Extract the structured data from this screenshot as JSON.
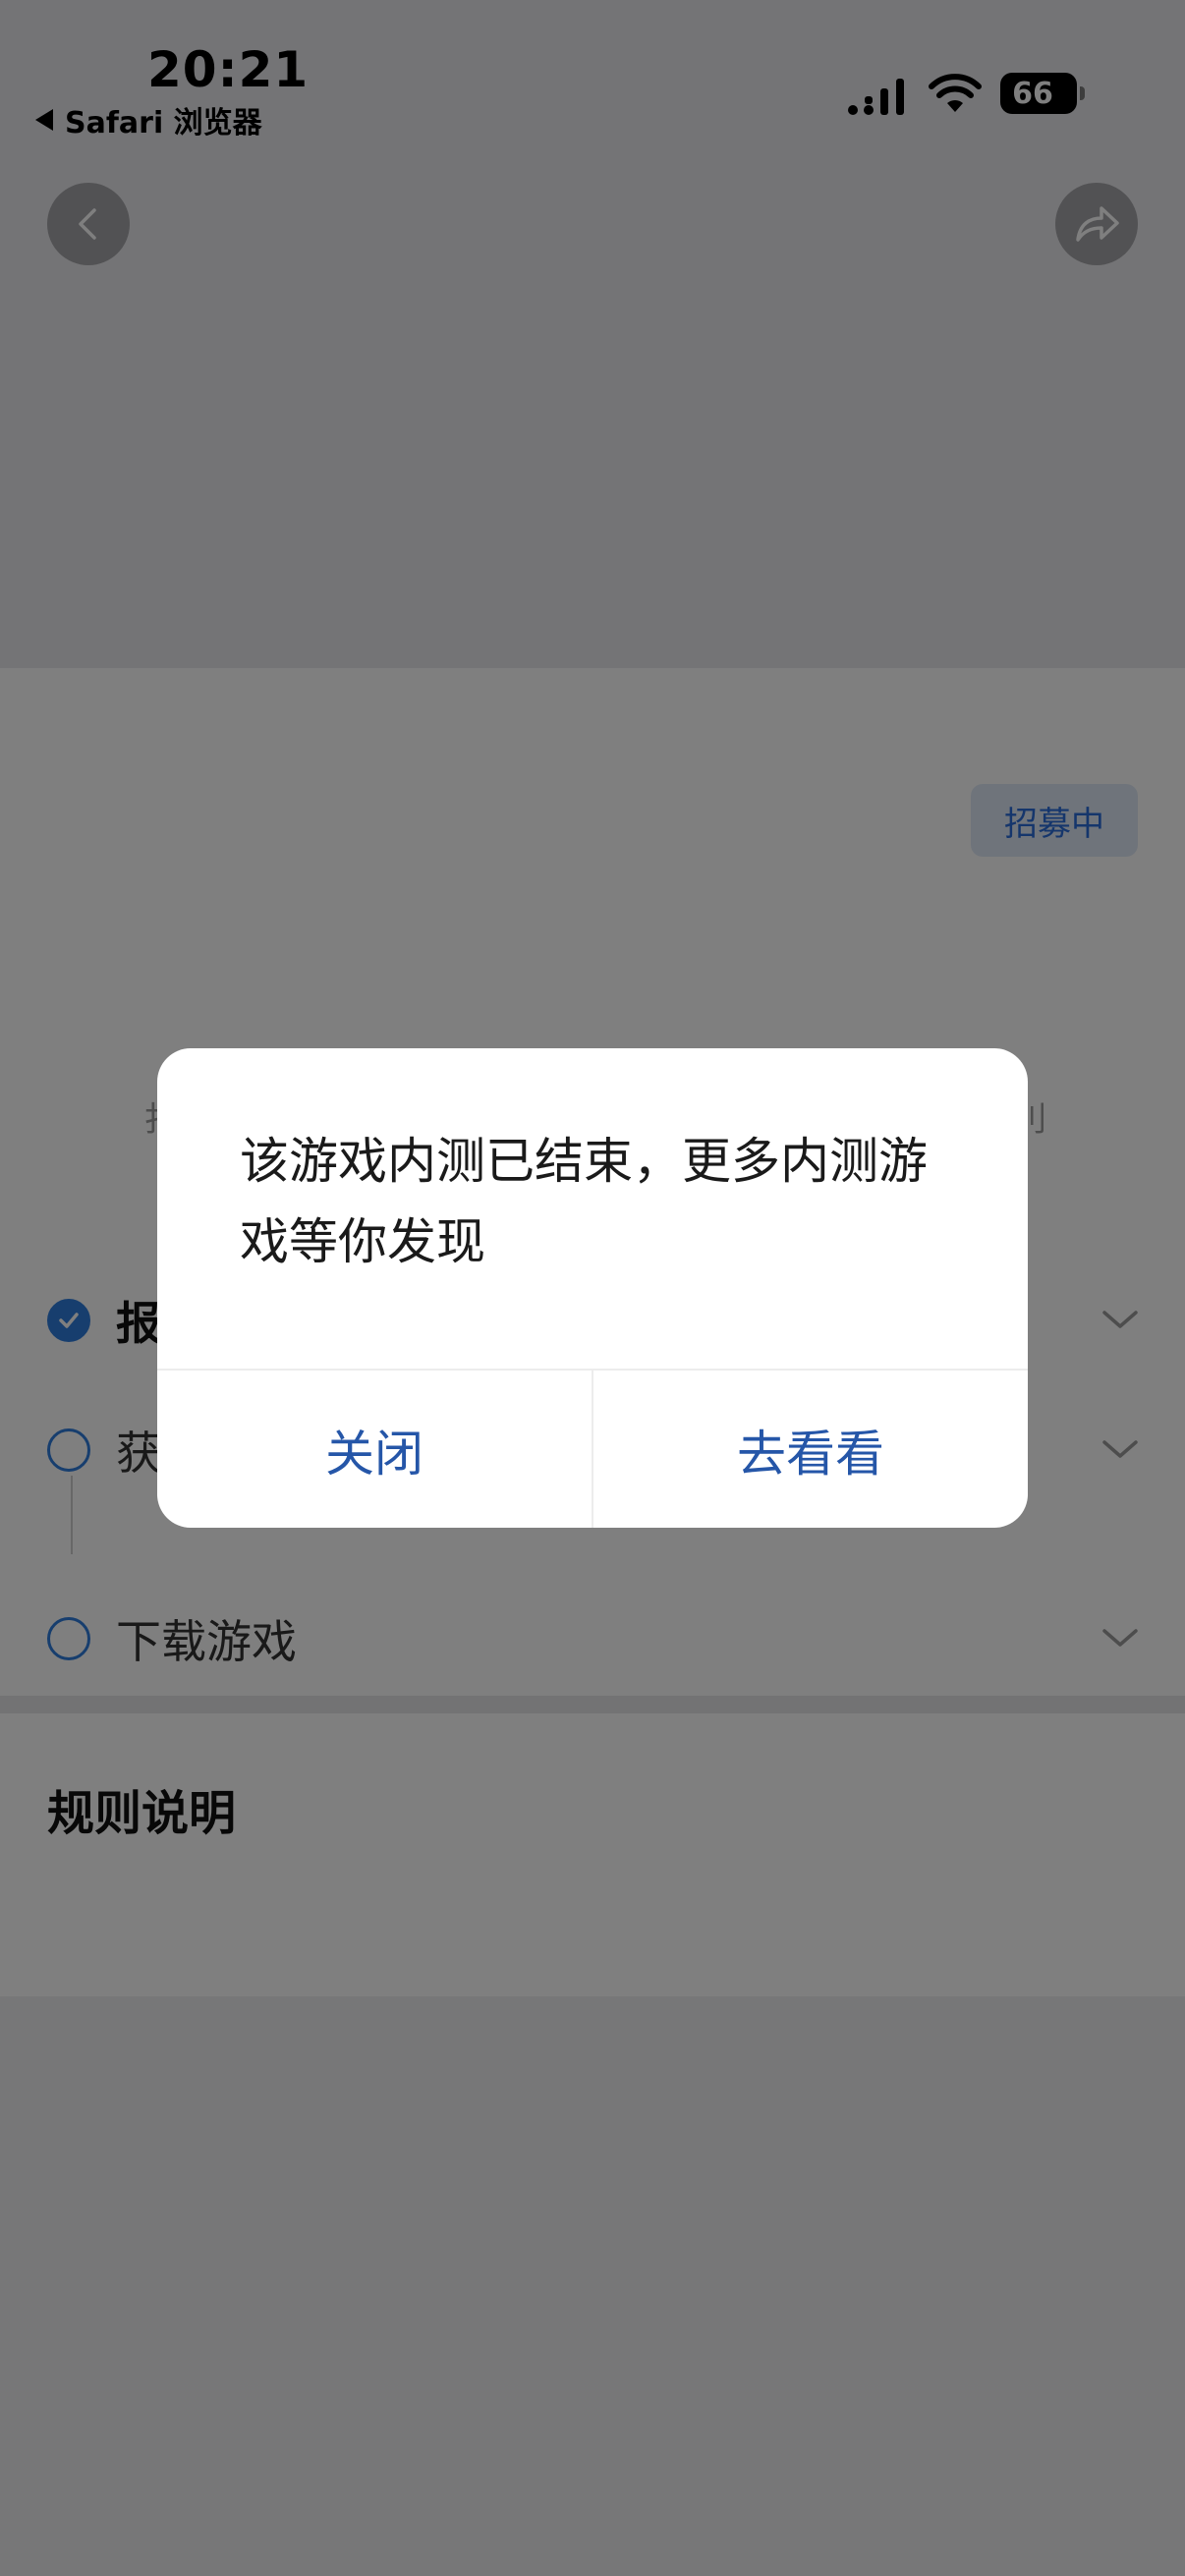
{
  "status_bar": {
    "time": "20:21",
    "back_app_label": "Safari 浏览器",
    "battery_level": "66"
  },
  "header": {
    "back_icon": "chevron-left-icon",
    "share_icon": "share-icon"
  },
  "content": {
    "recruit_badge": "招募中",
    "hint_left": "扌",
    "hint_right": "刂",
    "steps": [
      {
        "label": "报",
        "done": true
      },
      {
        "label": "获",
        "done": false
      },
      {
        "label": "下载游戏",
        "done": false
      }
    ]
  },
  "rules": {
    "title": "规则说明"
  },
  "dialog": {
    "message": "该游戏内测已结束，更多内测游戏等你发现",
    "close_label": "关闭",
    "go_label": "去看看"
  },
  "colors": {
    "accent": "#2f7ddd",
    "dialog_button": "#2556a8",
    "badge_bg": "#dfe9f7"
  }
}
